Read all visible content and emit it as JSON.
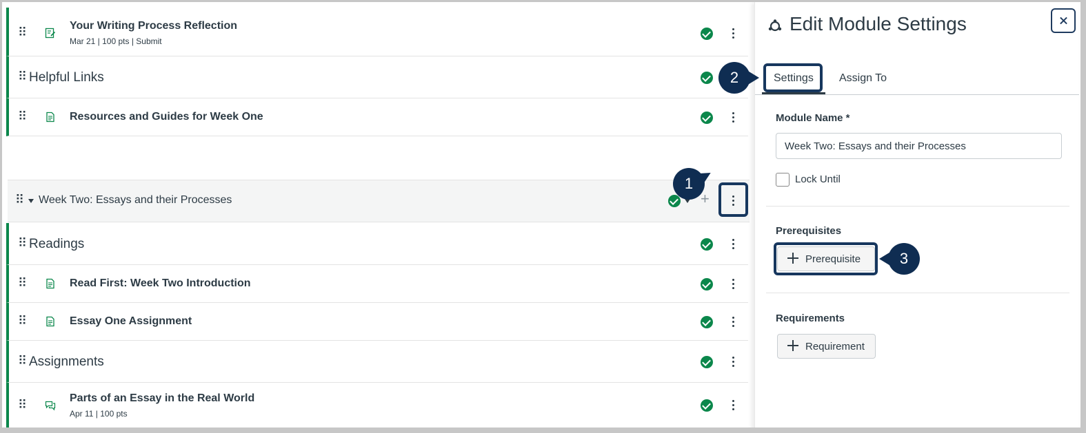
{
  "module_list": {
    "rows_top": [
      {
        "kind": "item",
        "icon": "assignment-icon",
        "title": "Your Writing Process Reflection",
        "meta": "Mar 21  |  100 pts  |  Submit"
      },
      {
        "kind": "header",
        "title": "Helpful Links"
      },
      {
        "kind": "item",
        "icon": "page-icon",
        "title": "Resources and Guides for Week One",
        "meta": ""
      }
    ],
    "module_header": {
      "title": "Week Two: Essays and their Processes",
      "add_symbol": "+"
    },
    "rows_bottom": [
      {
        "kind": "header",
        "title": "Readings"
      },
      {
        "kind": "item",
        "icon": "page-icon",
        "title": "Read First: Week Two Introduction",
        "meta": ""
      },
      {
        "kind": "item",
        "icon": "page-icon",
        "title": "Essay One Assignment",
        "meta": ""
      },
      {
        "kind": "header",
        "title": "Assignments"
      },
      {
        "kind": "item",
        "icon": "discussion-icon",
        "title": "Parts of an Essay in the Real World",
        "meta": "Apr 11  |  100 pts"
      }
    ]
  },
  "tray": {
    "title": "Edit Module Settings",
    "close_symbol": "×",
    "tabs": [
      {
        "label": "Settings"
      },
      {
        "label": "Assign To"
      }
    ],
    "module_name_label": "Module Name *",
    "module_name_value": "Week Two: Essays and their Processes",
    "lock_until_label": "Lock Until",
    "prerequisites_label": "Prerequisites",
    "prerequisite_button": "Prerequisite",
    "requirements_label": "Requirements",
    "requirement_button": "Requirement"
  },
  "callouts": [
    "1",
    "2",
    "3"
  ],
  "colors": {
    "accent_green": "#0b874b",
    "callout_navy": "#0f2d52",
    "text": "#2d3b45"
  }
}
